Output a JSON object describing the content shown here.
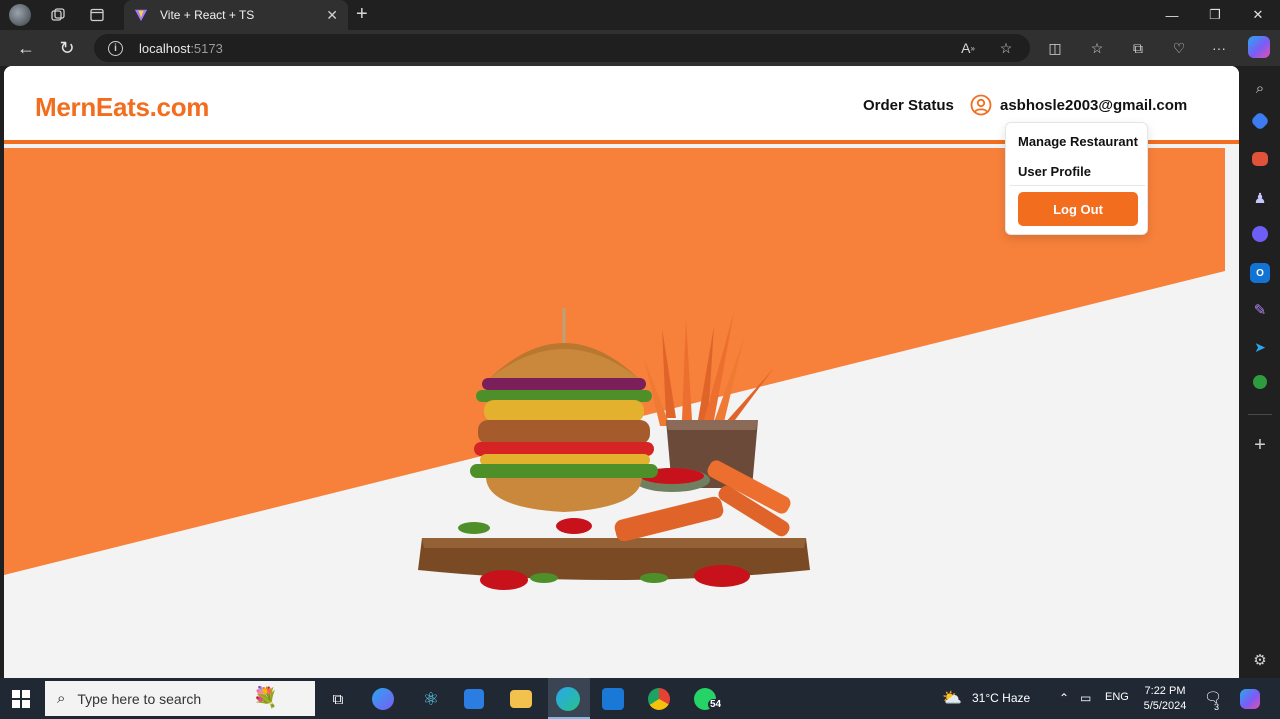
{
  "browser": {
    "tab_title": "Vite + React + TS",
    "url_host": "localhost",
    "url_port": ":5173"
  },
  "site": {
    "logo": "MernEats.com",
    "nav": {
      "order_status": "Order Status",
      "user_email": "asbhosle2003@gmail.com"
    },
    "dropdown": {
      "items": [
        "Manage Restaurant",
        "User Profile"
      ],
      "logout": "Log Out"
    },
    "colors": {
      "brand": "#f26d1d",
      "hero_orange": "#f7813b",
      "hero_light": "#f3f3f3"
    }
  },
  "taskbar": {
    "search_placeholder": "Type here to search",
    "whatsapp_badge": "54",
    "weather": "31°C  Haze",
    "language": "ENG",
    "time": "7:22 PM",
    "date": "5/5/2024",
    "notifications": "3"
  }
}
